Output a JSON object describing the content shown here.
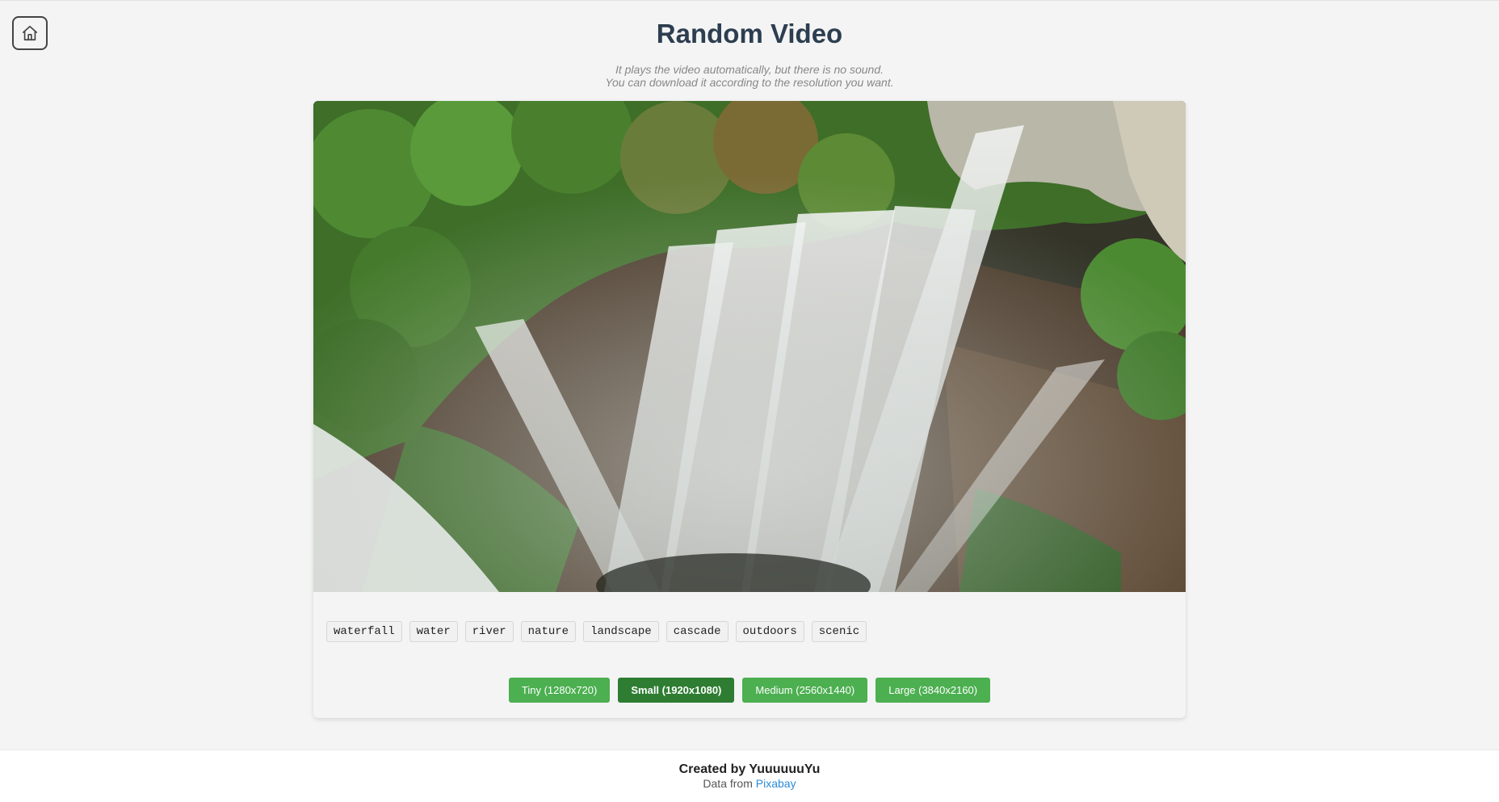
{
  "header": {
    "home_icon": "home-icon",
    "title": "Random Video",
    "subtitle_line1": "It plays the video automatically, but there is no sound.",
    "subtitle_line2": "You can download it according to the resolution you want."
  },
  "video": {
    "subject": "aerial view of waterfall"
  },
  "tags": [
    "waterfall",
    "water",
    "river",
    "nature",
    "landscape",
    "cascade",
    "outdoors",
    "scenic"
  ],
  "resolutions": [
    {
      "label": "Tiny (1280x720)",
      "active": false
    },
    {
      "label": "Small (1920x1080)",
      "active": true
    },
    {
      "label": "Medium (2560x1440)",
      "active": false
    },
    {
      "label": "Large (3840x2160)",
      "active": false
    }
  ],
  "footer": {
    "created_by": "Created by YuuuuuuYu",
    "data_from_prefix": "Data from",
    "data_source": "Pixabay"
  },
  "colors": {
    "title": "#2c3e50",
    "button": "#4caf50",
    "button_active": "#2e7d32",
    "link": "#2a8bd8"
  }
}
